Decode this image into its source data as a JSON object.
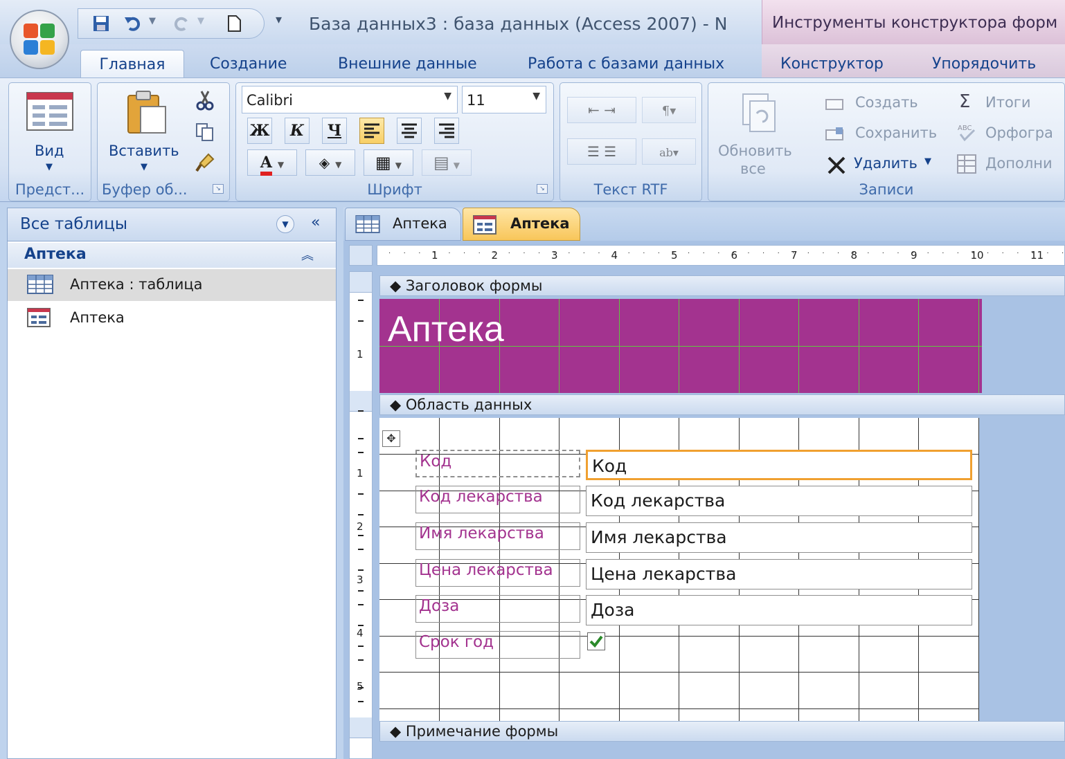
{
  "title_bar": {
    "title": "База данных3 : база данных (Access 2007) - N",
    "contextual_tools": "Инструменты конструктора форм"
  },
  "tabs": [
    {
      "label": "Главная",
      "active": true
    },
    {
      "label": "Создание"
    },
    {
      "label": "Внешние данные"
    },
    {
      "label": "Работа с базами данных"
    },
    {
      "label": "Конструктор"
    },
    {
      "label": "Упорядочить"
    }
  ],
  "ribbon": {
    "views": {
      "label": "Вид",
      "group": "Предст..."
    },
    "clipboard": {
      "paste": "Вставить",
      "group": "Буфер об..."
    },
    "font": {
      "name": "Calibri",
      "size": "11",
      "bold": "Ж",
      "italic": "К",
      "underline": "Ч",
      "group": "Шрифт"
    },
    "rtf": {
      "group": "Текст RTF"
    },
    "records": {
      "refresh_line1": "Обновить",
      "refresh_line2": "все",
      "new": "Создать",
      "save": "Сохранить",
      "delete": "Удалить",
      "totals": "Итоги",
      "spelling": "Орфогра",
      "more": "Дополни",
      "group": "Записи"
    }
  },
  "nav_pane": {
    "header": "Все таблицы",
    "group": "Аптека",
    "items": [
      {
        "label": "Аптека : таблица",
        "icon": "table-icon",
        "selected": true
      },
      {
        "label": "Аптека",
        "icon": "form-icon"
      }
    ]
  },
  "document": {
    "tabs": [
      {
        "label": "Аптека",
        "icon": "table-icon"
      },
      {
        "label": "Аптека",
        "icon": "form-icon",
        "active": true
      }
    ],
    "ruler_numbers": [
      "1",
      "2",
      "3",
      "4",
      "5",
      "6",
      "7",
      "8",
      "9",
      "10",
      "11"
    ],
    "vruler_header": [
      "1"
    ],
    "vruler_detail": [
      "1",
      "2",
      "3",
      "4",
      "5"
    ],
    "sections": {
      "header": "Заголовок формы",
      "detail": "Область данных",
      "footer": "Примечание формы"
    },
    "form_title": "Аптека",
    "fields": [
      {
        "label": "Код",
        "control": "Код",
        "selected": true
      },
      {
        "label": "Код лекарства",
        "control": "Код лекарства"
      },
      {
        "label": "Имя лекарства",
        "control": "Имя лекарства"
      },
      {
        "label": "Цена лекарства",
        "control": "Цена лекарства"
      },
      {
        "label": "Доза",
        "control": "Доза"
      },
      {
        "label": "Срок год",
        "control_type": "checkbox",
        "checked": true
      }
    ]
  },
  "colors": {
    "form_header": "#a3338f",
    "label_text": "#a3338f",
    "selection": "#f0a030",
    "grid": "#60c840"
  }
}
